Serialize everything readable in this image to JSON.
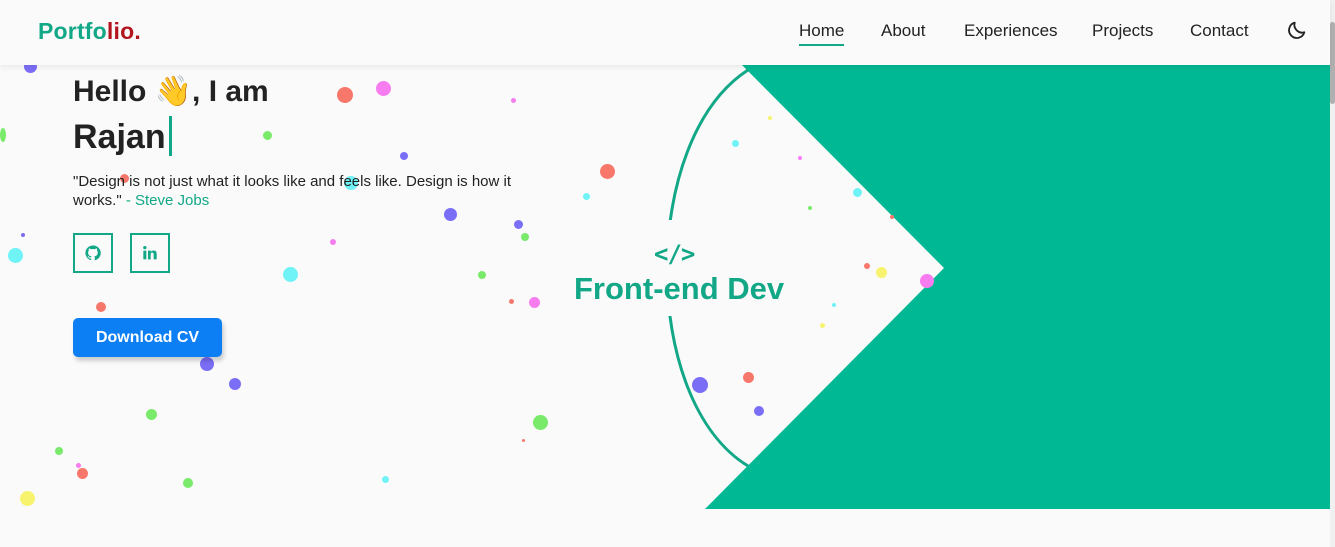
{
  "logo": {
    "part1": "Portfo",
    "part2": "lio."
  },
  "nav": {
    "links": [
      "Home",
      "About",
      "Experiences",
      "Projects",
      "Contact"
    ],
    "active": "Home",
    "theme_toggle_icon": "moon-icon"
  },
  "hero": {
    "hello": "Hello 👋, I am",
    "name": "Rajan",
    "quote": "\"Design is not just what it looks like and feels like. Design is how it works.\"",
    "quote_author": "- Steve Jobs",
    "social": [
      {
        "icon": "github-icon"
      },
      {
        "icon": "linkedin-icon"
      }
    ],
    "download_label": "Download CV"
  },
  "art": {
    "code_symbol": "</>",
    "role": "Front-end Dev"
  },
  "colors": {
    "accent": "#12a887",
    "logo_red": "#b3151f",
    "panel": "#00b894",
    "button": "#0d7ff5"
  }
}
